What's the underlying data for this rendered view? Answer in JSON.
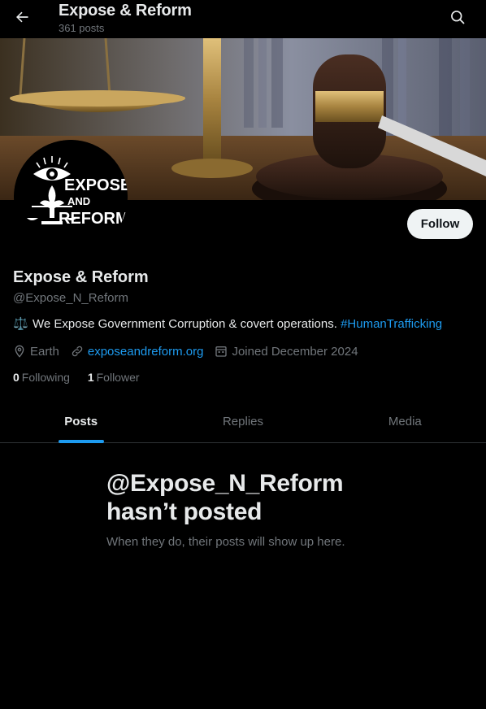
{
  "header": {
    "title": "Expose & Reform",
    "post_count": "361 posts",
    "back_icon": "arrow-left-icon",
    "search_icon": "search-icon"
  },
  "banner": {
    "description_icon": "gavel-and-scales-banner"
  },
  "avatar": {
    "logo_text_line1": "EXPOSE",
    "logo_text_line2": "AND",
    "logo_text_line3": "REFORM"
  },
  "follow_button": {
    "label": "Follow"
  },
  "profile": {
    "name": "Expose & Reform",
    "handle": "@Expose_N_Reform",
    "bio_emoji": "⚖️",
    "bio_text": "We Expose Government Corruption & covert operations.",
    "bio_hashtag": "#HumanTrafficking",
    "location": "Earth",
    "website": "exposeandreform.org",
    "joined": "Joined December 2024",
    "following_count": "0",
    "following_label": "Following",
    "followers_count": "1",
    "followers_label": "Follower"
  },
  "tabs": [
    {
      "label": "Posts",
      "active": true
    },
    {
      "label": "Replies",
      "active": false
    },
    {
      "label": "Media",
      "active": false
    }
  ],
  "empty_state": {
    "title": "@Expose_N_Reform hasn’t posted",
    "subtitle": "When they do, their posts will show up here."
  },
  "colors": {
    "accent": "#1d9bf0",
    "background": "#000000",
    "muted": "#71767b",
    "text": "#e7e9ea"
  }
}
